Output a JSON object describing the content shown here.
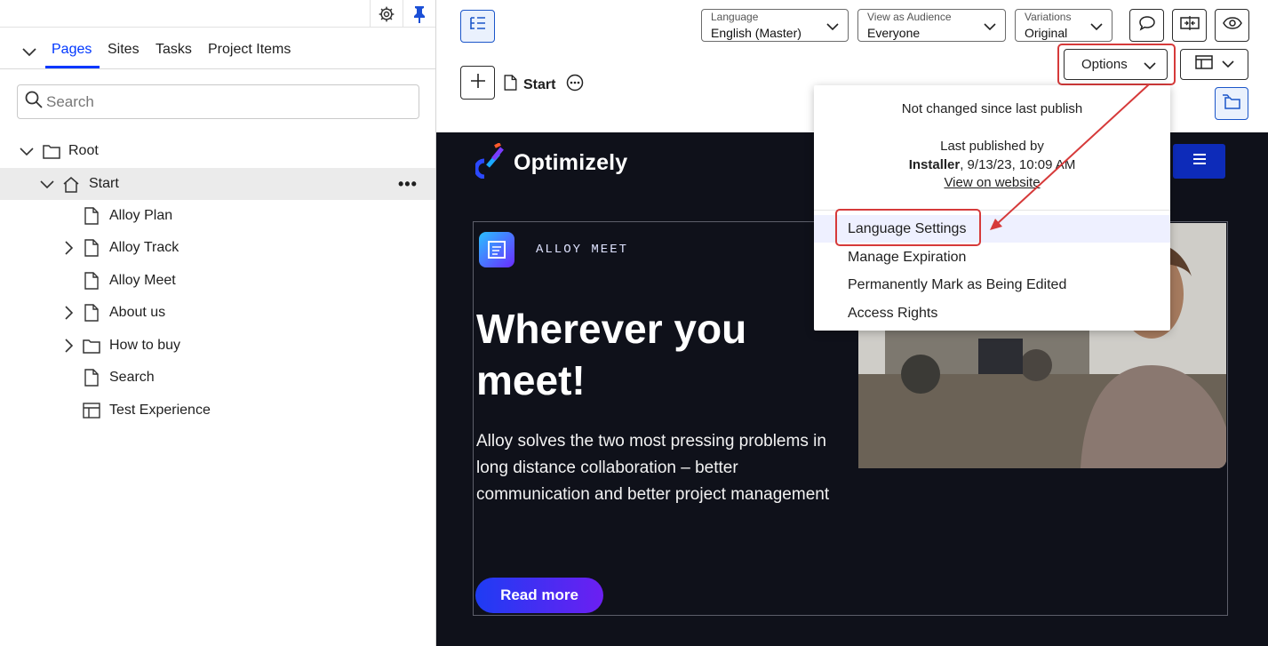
{
  "left_panel": {
    "tabs": [
      {
        "label": "Pages"
      },
      {
        "label": "Sites"
      },
      {
        "label": "Tasks"
      },
      {
        "label": "Project Items"
      }
    ],
    "search": {
      "placeholder": "Search"
    },
    "tree": [
      {
        "label": "Root",
        "icon": "folder-icon",
        "expanded": true
      },
      {
        "label": "Start",
        "icon": "home-icon",
        "expanded": true,
        "selected": true
      },
      {
        "label": "Alloy Plan",
        "icon": "page-icon"
      },
      {
        "label": "Alloy Track",
        "icon": "page-icon",
        "has_children": true
      },
      {
        "label": "Alloy Meet",
        "icon": "page-icon"
      },
      {
        "label": "About us",
        "icon": "page-icon",
        "has_children": true
      },
      {
        "label": "How to buy",
        "icon": "folder-icon",
        "has_children": true
      },
      {
        "label": "Search",
        "icon": "page-icon"
      },
      {
        "label": "Test Experience",
        "icon": "experience-icon"
      }
    ],
    "more_label": "•••"
  },
  "toolbar": {
    "language": {
      "label": "Language",
      "value": "English (Master)"
    },
    "audience": {
      "label": "View as Audience",
      "value": "Everyone"
    },
    "variations": {
      "label": "Variations",
      "value": "Original"
    },
    "options_label": "Options",
    "breadcrumb_title": "Start"
  },
  "options_menu": {
    "status": "Not changed since last publish",
    "published_by_label": "Last published by",
    "publisher": "Installer",
    "published_date": ", 9/13/23, 10:09 AM",
    "view_link": "View on website",
    "items": [
      {
        "label": "Language Settings"
      },
      {
        "label": "Manage Expiration"
      },
      {
        "label": "Permanently Mark as Being Edited"
      },
      {
        "label": "Access Rights"
      }
    ]
  },
  "preview": {
    "brand": "Optimizely",
    "tag": "ALLOY MEET",
    "headline": "Wherever you meet!",
    "body": "Alloy solves the two most pressing problems in long distance collaboration – better communication and better project management",
    "cta": "Read more"
  },
  "colors": {
    "accent": "#0037ff",
    "highlight": "#d63a3a",
    "preview_bg": "#0f111a"
  }
}
